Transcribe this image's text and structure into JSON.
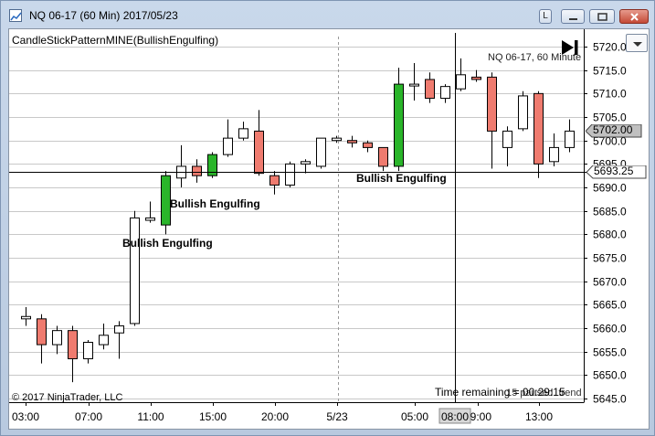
{
  "window": {
    "title": "NQ 06-17 (60 Min)  2017/05/23",
    "buttons": {
      "l": "L"
    }
  },
  "chart": {
    "indicator_label": "CandleStickPatternMINE(BullishEngulfing)",
    "instrument_label": "NQ 06-17, 60 Minute",
    "copyright": "© 2017 NinjaTrader, LLC",
    "time_remaining": "Time remaining = 00:29:15",
    "time_remaining_ghost": "15 paused. trend",
    "pattern_labels": [
      "Bullish Engulfing",
      "Bullish Engulfing",
      "Bullish Engulfing"
    ],
    "current_price": "5702.00",
    "crosshair_price": "5693.25",
    "crosshair_time": "08:00",
    "y_ticks": [
      "5720.0",
      "5715.0",
      "5710.0",
      "5705.0",
      "5700.0",
      "5695.0",
      "5690.0",
      "5685.0",
      "5680.0",
      "5675.0",
      "5670.0",
      "5665.0",
      "5660.0",
      "5655.0",
      "5650.0",
      "5645.0"
    ],
    "x_ticks": [
      "03:00",
      "07:00",
      "11:00",
      "15:00",
      "20:00",
      "5/23",
      "05:00",
      "09:00",
      "13:00"
    ],
    "colors": {
      "up": "#ffffff",
      "bull_pattern": "#2ab52a",
      "down": "#ef7b6f",
      "grid": "#c8c8c8",
      "crosshair": "#000000"
    }
  },
  "chart_data": {
    "type": "candlestick",
    "title": "NQ 06-17 (60 Min)",
    "ylim": [
      5645,
      5722
    ],
    "x_ticks": [
      "03:00",
      "07:00",
      "11:00",
      "15:00",
      "20:00",
      "5/23",
      "05:00",
      "09:00",
      "13:00"
    ],
    "y_ticks": [
      5720,
      5715,
      5710,
      5705,
      5700,
      5695,
      5690,
      5685,
      5680,
      5675,
      5670,
      5665,
      5660,
      5655,
      5650,
      5645
    ],
    "candles": [
      {
        "o": 5662.0,
        "h": 5664.5,
        "l": 5660.5,
        "c": 5662.5,
        "style": "up"
      },
      {
        "o": 5662.0,
        "h": 5663.0,
        "l": 5652.5,
        "c": 5656.5,
        "style": "down"
      },
      {
        "o": 5656.5,
        "h": 5660.5,
        "l": 5654.5,
        "c": 5659.5,
        "style": "up"
      },
      {
        "o": 5659.5,
        "h": 5660.5,
        "l": 5648.5,
        "c": 5653.5,
        "style": "down"
      },
      {
        "o": 5653.5,
        "h": 5657.5,
        "l": 5652.5,
        "c": 5657.0,
        "style": "up"
      },
      {
        "o": 5656.5,
        "h": 5661.0,
        "l": 5655.5,
        "c": 5658.5,
        "style": "up"
      },
      {
        "o": 5659.0,
        "h": 5661.5,
        "l": 5653.5,
        "c": 5660.5,
        "style": "up"
      },
      {
        "o": 5661.0,
        "h": 5685.0,
        "l": 5660.5,
        "c": 5683.5,
        "style": "up"
      },
      {
        "o": 5683.0,
        "h": 5687.0,
        "l": 5682.5,
        "c": 5683.5,
        "style": "up"
      },
      {
        "o": 5682.0,
        "h": 5693.5,
        "l": 5680.0,
        "c": 5692.5,
        "style": "bull"
      },
      {
        "o": 5692.0,
        "h": 5699.0,
        "l": 5690.0,
        "c": 5694.5,
        "style": "up"
      },
      {
        "o": 5694.5,
        "h": 5696.0,
        "l": 5691.0,
        "c": 5692.5,
        "style": "down"
      },
      {
        "o": 5692.5,
        "h": 5697.5,
        "l": 5692.0,
        "c": 5697.0,
        "style": "bull"
      },
      {
        "o": 5697.0,
        "h": 5704.5,
        "l": 5696.5,
        "c": 5700.5,
        "style": "up"
      },
      {
        "o": 5700.5,
        "h": 5704.0,
        "l": 5700.0,
        "c": 5702.5,
        "style": "up"
      },
      {
        "o": 5702.0,
        "h": 5706.5,
        "l": 5692.5,
        "c": 5693.0,
        "style": "down"
      },
      {
        "o": 5692.5,
        "h": 5693.5,
        "l": 5688.5,
        "c": 5690.5,
        "style": "down"
      },
      {
        "o": 5690.5,
        "h": 5695.5,
        "l": 5690.0,
        "c": 5695.0,
        "style": "up"
      },
      {
        "o": 5695.0,
        "h": 5696.0,
        "l": 5693.0,
        "c": 5695.5,
        "style": "up"
      },
      {
        "o": 5694.5,
        "h": 5700.5,
        "l": 5694.0,
        "c": 5700.5,
        "style": "up"
      },
      {
        "o": 5700.5,
        "h": 5701.0,
        "l": 5699.5,
        "c": 5700.0,
        "style": "up"
      },
      {
        "o": 5700.0,
        "h": 5701.0,
        "l": 5698.5,
        "c": 5699.5,
        "style": "down"
      },
      {
        "o": 5699.5,
        "h": 5700.0,
        "l": 5697.5,
        "c": 5698.5,
        "style": "down"
      },
      {
        "o": 5698.5,
        "h": 5698.5,
        "l": 5693.5,
        "c": 5694.5,
        "style": "down"
      },
      {
        "o": 5694.5,
        "h": 5715.5,
        "l": 5693.5,
        "c": 5712.0,
        "style": "bull"
      },
      {
        "o": 5712.0,
        "h": 5716.5,
        "l": 5708.5,
        "c": 5712.0,
        "style": "up"
      },
      {
        "o": 5713.0,
        "h": 5714.5,
        "l": 5708.0,
        "c": 5709.0,
        "style": "down"
      },
      {
        "o": 5709.0,
        "h": 5712.0,
        "l": 5708.0,
        "c": 5711.5,
        "style": "up"
      },
      {
        "o": 5711.0,
        "h": 5717.5,
        "l": 5710.5,
        "c": 5714.0,
        "style": "up"
      },
      {
        "o": 5713.5,
        "h": 5715.0,
        "l": 5712.5,
        "c": 5713.0,
        "style": "down"
      },
      {
        "o": 5713.5,
        "h": 5714.5,
        "l": 5694.0,
        "c": 5702.0,
        "style": "down"
      },
      {
        "o": 5698.5,
        "h": 5703.0,
        "l": 5694.5,
        "c": 5702.0,
        "style": "up"
      },
      {
        "o": 5702.5,
        "h": 5710.5,
        "l": 5702.0,
        "c": 5709.5,
        "style": "up"
      },
      {
        "o": 5710.0,
        "h": 5710.5,
        "l": 5692.0,
        "c": 5695.0,
        "style": "down"
      },
      {
        "o": 5695.5,
        "h": 5701.5,
        "l": 5694.5,
        "c": 5698.5,
        "style": "up"
      },
      {
        "o": 5698.5,
        "h": 5704.5,
        "l": 5697.5,
        "c": 5702.0,
        "style": "up"
      }
    ]
  }
}
